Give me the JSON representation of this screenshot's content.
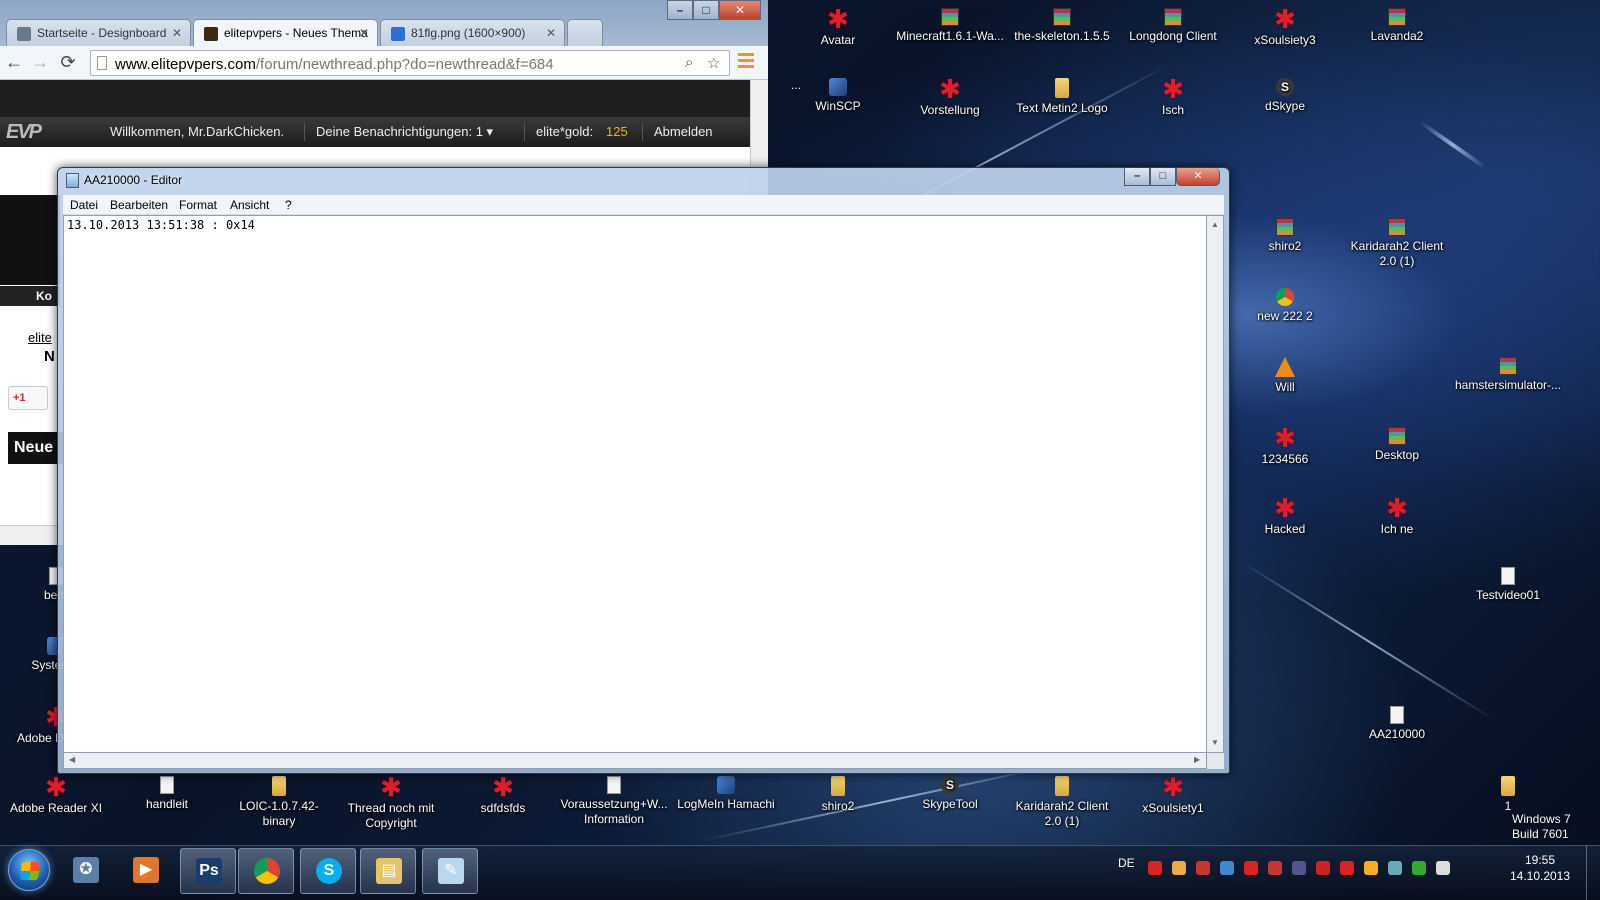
{
  "browser": {
    "tabs": [
      {
        "label": "Startseite - Designboard",
        "fav_color": "#6a7a8a"
      },
      {
        "label": "elitepvpers - Neues Thema",
        "fav_color": "#3a2b10"
      },
      {
        "label": "81flg.png (1600×900)",
        "fav_color": "#2e6fd0"
      }
    ],
    "window_controls": {
      "minimize": "–",
      "maximize": "□",
      "close": "✕"
    },
    "nav": {
      "back": "←",
      "forward": "→",
      "reload": "⟳"
    },
    "url_host": "www.elitepvpers.com",
    "url_path": "/forum/newthread.php?do=newthread&f=684",
    "site": {
      "logo": "EVP",
      "welcome": "Willkommen, Mr.DarkChicken.",
      "notifications": "Deine Benachrichtigungen: 1 ▾",
      "gold_label": "elite*gold:",
      "gold_value": "125",
      "logout": "Abmelden",
      "dark_tab": "Ko",
      "crumb1": "elite",
      "crumb2": "N",
      "gplus": "+1",
      "new_topic": "Neue"
    }
  },
  "notepad": {
    "title": "AA210000 - Editor",
    "menu": [
      "Datei",
      "Bearbeiten",
      "Format",
      "Ansicht",
      "?"
    ],
    "content": "13.10.2013 13:51:38 : 0x14",
    "controls": {
      "minimize": "–",
      "maximize": "□",
      "close": "✕"
    }
  },
  "desktop": {
    "icons": [
      {
        "label": "Avatar",
        "type": "star"
      },
      {
        "label": "Minecraft1.6.1-Wa...",
        "type": "rar"
      },
      {
        "label": "the-skeleton.1.5.5",
        "type": "rar"
      },
      {
        "label": "Longdong Client",
        "type": "rar"
      },
      {
        "label": "xSoulsiety3",
        "type": "star"
      },
      {
        "label": "Lavanda2",
        "type": "rar"
      },
      {
        "label": "WinSCP",
        "type": "app"
      },
      {
        "label": "Vorstellung",
        "type": "star"
      },
      {
        "label": "Text Metin2 Logo",
        "type": "folder"
      },
      {
        "label": "Isch",
        "type": "star"
      },
      {
        "label": "dSkype",
        "type": "skype"
      },
      {
        "label": "shiro2",
        "type": "rar"
      },
      {
        "label": "Karidarah2 Client 2.0 (1)",
        "type": "rar"
      },
      {
        "label": "new 222 2",
        "type": "chrome"
      },
      {
        "label": "hamstersimulator-...",
        "type": "rar"
      },
      {
        "label": "Will",
        "type": "vlc"
      },
      {
        "label": "1234566",
        "type": "star"
      },
      {
        "label": "Desktop",
        "type": "rar"
      },
      {
        "label": "Hacked",
        "type": "star"
      },
      {
        "label": "Ich ne",
        "type": "star"
      },
      {
        "label": "Testvideo01",
        "type": "doc"
      },
      {
        "label": "AA210000",
        "type": "doc"
      },
      {
        "label": "Adobe Reader XI",
        "type": "star"
      },
      {
        "label": "handleit",
        "type": "doc"
      },
      {
        "label": "LOIC-1.0.7.42-binary",
        "type": "folder"
      },
      {
        "label": "Thread noch mit Copyright",
        "type": "star"
      },
      {
        "label": "sdfdsfds",
        "type": "star"
      },
      {
        "label": "Voraussetzung+W... Information",
        "type": "doc"
      },
      {
        "label": "LogMeIn Hamachi",
        "type": "app"
      },
      {
        "label": "shiro2",
        "type": "folder"
      },
      {
        "label": "SkypeTool",
        "type": "skype"
      },
      {
        "label": "Karidarah2 Client 2.0 (1)",
        "type": "folder"
      },
      {
        "label": "xSoulsiety1",
        "type": "star"
      },
      {
        "label": "1",
        "type": "folder"
      },
      {
        "label": "benr",
        "type": "doc"
      },
      {
        "label": "Systemst",
        "type": "app"
      },
      {
        "label": "Adobe D Assis",
        "type": "star"
      },
      {
        "label": "...",
        "type": "none"
      }
    ]
  },
  "watermark": {
    "line1": "Windows 7",
    "line2": "Build 7601"
  },
  "taskbar": {
    "apps": [
      {
        "name": "media-center",
        "color": "#5a7fa8",
        "glyph": "✪"
      },
      {
        "name": "media-player",
        "color": "#e0772a",
        "glyph": "▶"
      },
      {
        "name": "photoshop",
        "color": "#1a3b6e",
        "glyph": "Ps"
      },
      {
        "name": "chrome",
        "color": "#ffffff",
        "glyph": ""
      },
      {
        "name": "skype",
        "color": "#00aff0",
        "glyph": "S"
      },
      {
        "name": "explorer",
        "color": "#e8c266",
        "glyph": "▤"
      },
      {
        "name": "notepad",
        "color": "#b9d8ef",
        "glyph": "✎"
      }
    ],
    "language": "DE",
    "tray_colors": [
      "#d22",
      "#ea4",
      "#c33",
      "#48c",
      "#d22",
      "#c33",
      "#558",
      "#c22",
      "#d22",
      "#fa2",
      "#6ab",
      "#3a3",
      "#ddd"
    ],
    "time": "19:55",
    "date": "14.10.2013"
  }
}
